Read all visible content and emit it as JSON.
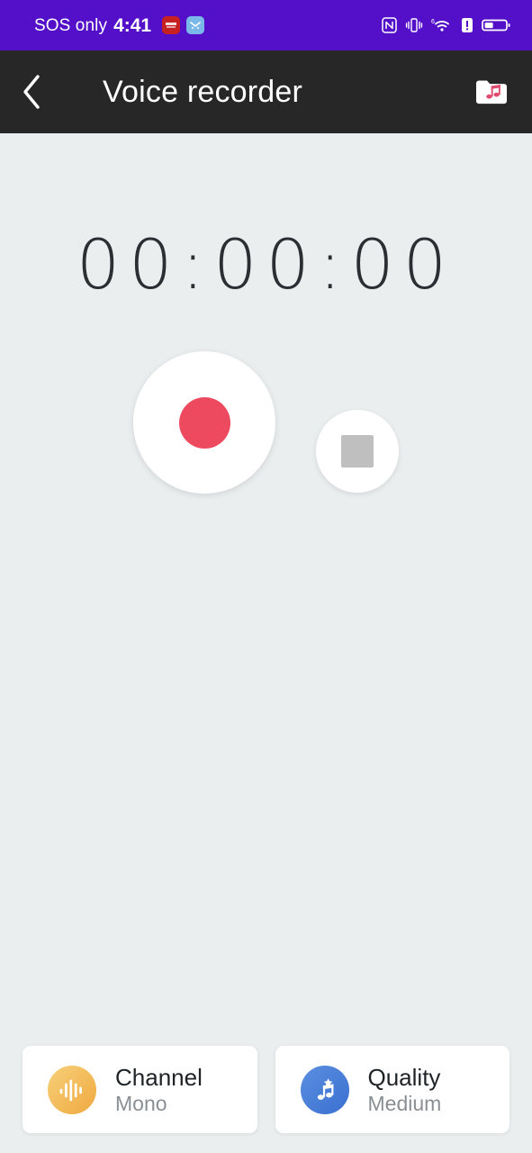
{
  "status_bar": {
    "carrier": "SOS only",
    "time": "4:41",
    "app_icons": [
      {
        "name": "notification-app-icon",
        "color": "#C62020"
      },
      {
        "name": "messaging-app-icon",
        "color": "#79B8E8"
      }
    ],
    "right_icons": [
      "nfc-icon",
      "vibrate-icon",
      "wifi-6-icon",
      "alert-icon",
      "battery-icon"
    ],
    "background": "#5310C8"
  },
  "app_bar": {
    "back_label": "back",
    "title": "Voice recorder",
    "folder_label": "recordings",
    "background": "#272727"
  },
  "recorder": {
    "timer": "00:00:00",
    "record_button_label": "Record",
    "stop_button_label": "Stop",
    "record_color": "#ED4A60",
    "stop_color": "#BFBFBF"
  },
  "settings_cards": [
    {
      "icon": "waveform-icon",
      "title": "Channel",
      "value": "Mono",
      "accent": "#EFA93F"
    },
    {
      "icon": "music-star-icon",
      "title": "Quality",
      "value": "Medium",
      "accent": "#3A6FD0"
    }
  ],
  "theme": {
    "background": "#EBEEEF",
    "card_background": "#FFFFFF"
  }
}
